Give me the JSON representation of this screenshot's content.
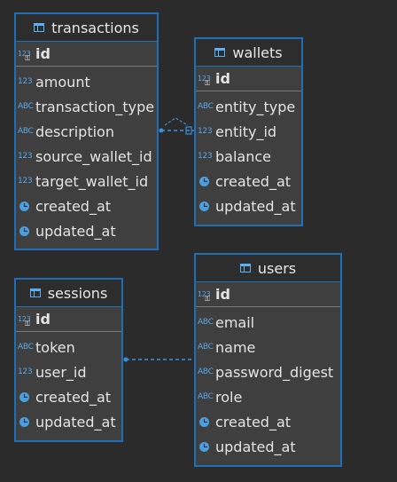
{
  "entities": {
    "transactions": {
      "name": "transactions",
      "pk": {
        "type_icon": "123",
        "name": "id"
      },
      "columns": [
        {
          "type_icon": "123",
          "name": "amount"
        },
        {
          "type_icon": "ABC",
          "name": "transaction_type"
        },
        {
          "type_icon": "ABC",
          "name": "description"
        },
        {
          "type_icon": "123",
          "name": "source_wallet_id"
        },
        {
          "type_icon": "123",
          "name": "target_wallet_id"
        },
        {
          "type_icon": "clock-icon",
          "name": "created_at"
        },
        {
          "type_icon": "clock-icon",
          "name": "updated_at"
        }
      ]
    },
    "wallets": {
      "name": "wallets",
      "pk": {
        "type_icon": "123",
        "name": "id"
      },
      "columns": [
        {
          "type_icon": "ABC",
          "name": "entity_type"
        },
        {
          "type_icon": "123",
          "name": "entity_id"
        },
        {
          "type_icon": "123",
          "name": "balance"
        },
        {
          "type_icon": "clock-icon",
          "name": "created_at"
        },
        {
          "type_icon": "clock-icon",
          "name": "updated_at"
        }
      ]
    },
    "sessions": {
      "name": "sessions",
      "pk": {
        "type_icon": "123",
        "name": "id"
      },
      "columns": [
        {
          "type_icon": "ABC",
          "name": "token"
        },
        {
          "type_icon": "123",
          "name": "user_id"
        },
        {
          "type_icon": "clock-icon",
          "name": "created_at"
        },
        {
          "type_icon": "clock-icon",
          "name": "updated_at"
        }
      ]
    },
    "users": {
      "name": "users",
      "pk": {
        "type_icon": "123",
        "name": "id"
      },
      "columns": [
        {
          "type_icon": "ABC",
          "name": "email"
        },
        {
          "type_icon": "ABC",
          "name": "name"
        },
        {
          "type_icon": "ABC",
          "name": "password_digest"
        },
        {
          "type_icon": "ABC",
          "name": "role"
        },
        {
          "type_icon": "clock-icon",
          "name": "created_at"
        },
        {
          "type_icon": "clock-icon",
          "name": "updated_at"
        }
      ]
    }
  },
  "colors": {
    "background": "#2b2b2b",
    "border": "#1f6fb8",
    "link": "#3d8fd6"
  }
}
